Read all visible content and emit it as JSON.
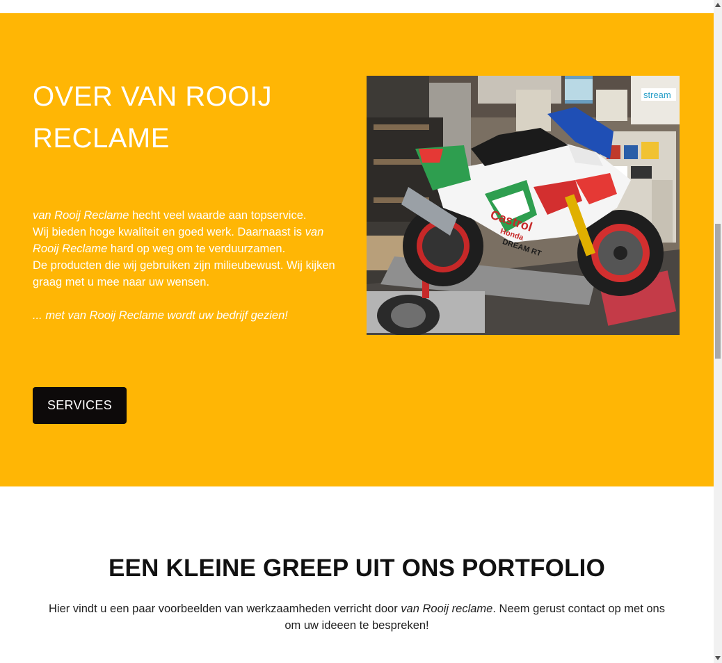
{
  "about": {
    "title_line1": "OVER VAN ROOIJ",
    "title_line2": "RECLAME",
    "p1_company": "van Rooij Reclame",
    "p1_rest": " hecht veel waarde aan topservice.",
    "p2_start": "Wij bieden hoge kwaliteit en goed werk. Daarnaast is ",
    "p2_company": "van Rooij Reclame",
    "p2_rest": " hard op weg om te verduurzamen.",
    "p3": "De producten die wij gebruiken zijn milieubewust. Wij kijken graag met u mee naar uw wensen.",
    "slogan": "... met van Rooij Reclame wordt uw bedrijf gezien!",
    "button_label": "SERVICES",
    "image_alt": "Honda Castrol racemotor op een aanhanger in de werkplaats",
    "background_color": "#FFB605"
  },
  "portfolio": {
    "title": "EEN KLEINE GREEP UIT ONS PORTFOLIO",
    "text_start": "Hier vindt u een paar voorbeelden van werkzaamheden verricht door ",
    "text_company": "van Rooij reclame",
    "text_rest": ". Neem gerust contact op met ons om uw ideeen te bespreken!"
  },
  "photo_labels": {
    "brand": "Castrol",
    "maker": "Honda",
    "team": "DREAM RT"
  },
  "icons": {
    "scroll_up": "scroll-up-arrow-icon",
    "scroll_down": "scroll-down-arrow-icon"
  }
}
